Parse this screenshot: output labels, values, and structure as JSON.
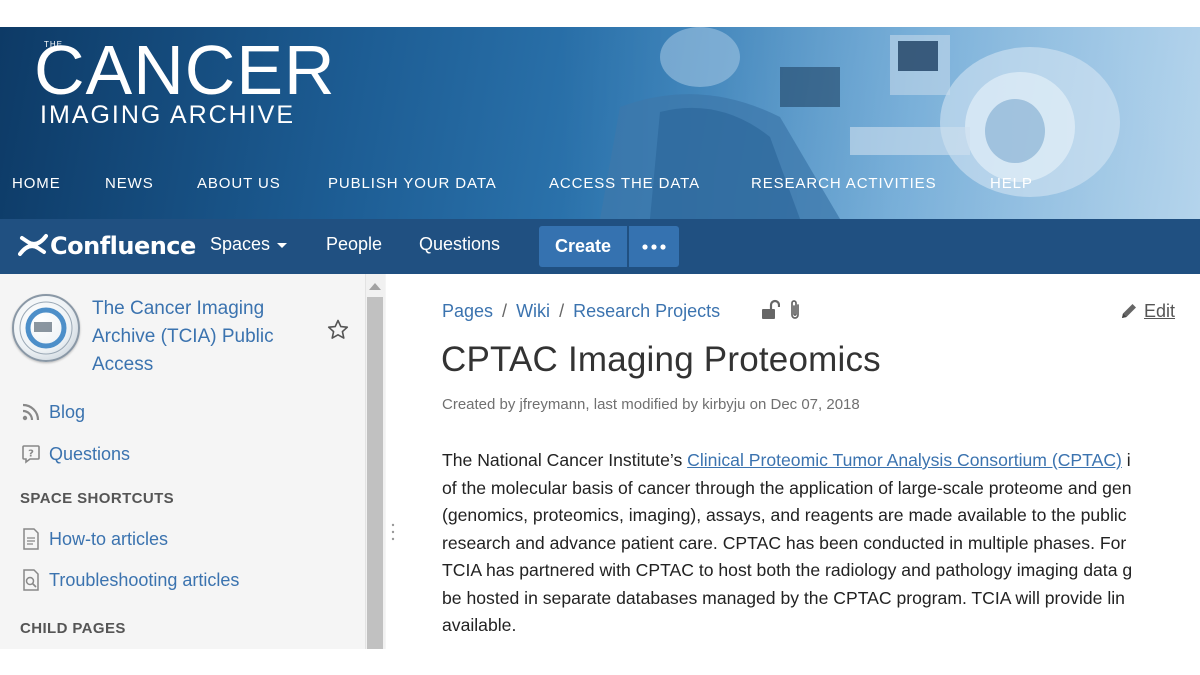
{
  "banner": {
    "logo_the": "THE",
    "logo_main": "CANCER",
    "logo_sub": "IMAGING ARCHIVE",
    "nav": [
      "HOME",
      "NEWS",
      "ABOUT US",
      "PUBLISH YOUR DATA",
      "ACCESS THE DATA",
      "RESEARCH ACTIVITIES",
      "HELP"
    ]
  },
  "confluence": {
    "brand": "Confluence",
    "spaces": "Spaces",
    "people": "People",
    "questions": "Questions",
    "create": "Create",
    "more": "•••",
    "colors": {
      "bar": "#205081",
      "button": "#3572b0"
    }
  },
  "sidebar": {
    "space_title": "The Cancer Imaging Archive (TCIA) Public Access",
    "links": {
      "blog": "Blog",
      "questions": "Questions"
    },
    "shortcuts_heading": "SPACE SHORTCUTS",
    "shortcuts": [
      "How-to articles",
      "Troubleshooting articles"
    ],
    "child_pages_heading": "CHILD PAGES"
  },
  "breadcrumb": [
    "Pages",
    "Wiki",
    "Research Projects"
  ],
  "breadcrumb_separator": "/",
  "edit_label": "Edit",
  "page": {
    "title": "CPTAC Imaging Proteomics",
    "meta": "Created by jfreymann, last modified by kirbyju on Dec 07, 2018",
    "para_intro": "The National Cancer Institute’s ",
    "para_link": "Clinical Proteomic Tumor Analysis Consortium (CPTAC)",
    "para_after_link": " i",
    "lines": [
      "of the molecular basis of cancer through the application of large-scale proteome and gen",
      "(genomics, proteomics, imaging), assays, and reagents are made available to the public",
      "research and advance patient care. CPTAC has been conducted in multiple phases.  For",
      "TCIA has partnered with CPTAC to host both the radiology and pathology imaging data g",
      "be hosted in separate databases managed by the CPTAC program.  TCIA will provide lin",
      "available."
    ]
  },
  "colors": {
    "link": "#3b73af",
    "text": "#333333",
    "sidebar_bg": "#f5f5f5"
  }
}
